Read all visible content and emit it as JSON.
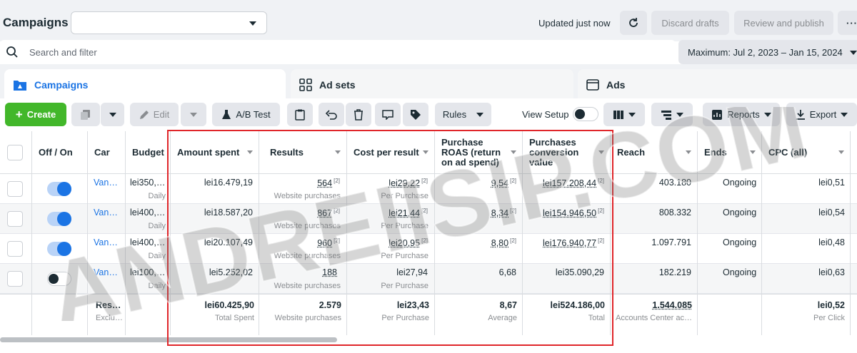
{
  "header": {
    "title": "Campaigns",
    "updated": "Updated just now",
    "discard_label": "Discard drafts",
    "review_label": "Review and publish",
    "more_label": "···"
  },
  "search": {
    "placeholder": "Search and filter"
  },
  "date_range": {
    "label": "Maximum: Jul 2, 2023 – Jan 15, 2024"
  },
  "tabs": [
    {
      "label": "Campaigns",
      "icon": "folder-icon"
    },
    {
      "label": "Ad sets",
      "icon": "grid-icon"
    },
    {
      "label": "Ads",
      "icon": "ad-icon"
    }
  ],
  "toolbar": {
    "create": "Create",
    "edit": "Edit",
    "ab_test": "A/B Test",
    "rules": "Rules",
    "view_setup": "View Setup",
    "reports": "Reports",
    "export": "Export"
  },
  "columns": {
    "off_on": "Off / On",
    "campaign": "Car",
    "budget": "Budget",
    "amount_spent": "Amount spent",
    "results": "Results",
    "cost_per_result": "Cost per result",
    "roas": [
      "Purchase",
      "ROAS (return",
      "on ad spend)"
    ],
    "conv_value": [
      "Purchases",
      "conversion",
      "value"
    ],
    "reach": "Reach",
    "ends": "Ends",
    "cpc": "CPC (all)"
  },
  "rows": [
    {
      "on": true,
      "name": "Van…",
      "budget": "lei350,…",
      "budget_sub": "Daily",
      "amount": "lei16.479,19",
      "results": "564",
      "results_sub": "Website purchases",
      "cpr": "lei29,22",
      "cpr_sub": "Per Purchase",
      "roas": "9,54",
      "conv": "lei157.208,44",
      "reach": "403.180",
      "ends": "Ongoing",
      "cpc": "lei0,51",
      "marked": true
    },
    {
      "on": true,
      "name": "Van…",
      "budget": "lei400,…",
      "budget_sub": "Daily",
      "amount": "lei18.587,20",
      "results": "867",
      "results_sub": "Website purchases",
      "cpr": "lei21,44",
      "cpr_sub": "Per Purchase",
      "roas": "8,34",
      "conv": "lei154.946,50",
      "reach": "808.332",
      "ends": "Ongoing",
      "cpc": "lei0,54",
      "marked": true
    },
    {
      "on": true,
      "name": "Van…",
      "budget": "lei400,…",
      "budget_sub": "Daily",
      "amount": "lei20.107,49",
      "results": "960",
      "results_sub": "Website purchases",
      "cpr": "lei20,95",
      "cpr_sub": "Per Purchase",
      "roas": "8,80",
      "conv": "lei176.940,77",
      "reach": "1.097.791",
      "ends": "Ongoing",
      "cpc": "lei0,48",
      "marked": true
    },
    {
      "on": false,
      "name": "Van…",
      "budget": "lei100,…",
      "budget_sub": "Daily",
      "amount": "lei5.252,02",
      "results": "188",
      "results_sub": "Website purchases",
      "cpr": "lei27,94",
      "cpr_sub": "Per Purchase",
      "roas": "6,68",
      "conv": "lei35.090,29",
      "reach": "182.219",
      "ends": "Ongoing",
      "cpc": "lei0,63",
      "marked": false
    }
  ],
  "totals": {
    "name": "Res…",
    "name_sub": "Exclu…",
    "amount": "lei60.425,90",
    "amount_sub": "Total Spent",
    "results": "2.579",
    "results_sub": "Website purchases",
    "cpr": "lei23,43",
    "cpr_sub": "Per Purchase",
    "roas": "8,67",
    "roas_sub": "Average",
    "conv": "lei524.186,00",
    "conv_sub": "Total",
    "reach": "1.544.085",
    "reach_sub": "Accounts Center ac…",
    "cpc": "lei0,52",
    "cpc_sub": "Per Click"
  },
  "footnote_mark": "[2]",
  "watermark": "ANDREIISIP.COM",
  "colors": {
    "accent": "#1b74e4",
    "create": "#42b72a",
    "highlight": "#e0262a"
  }
}
